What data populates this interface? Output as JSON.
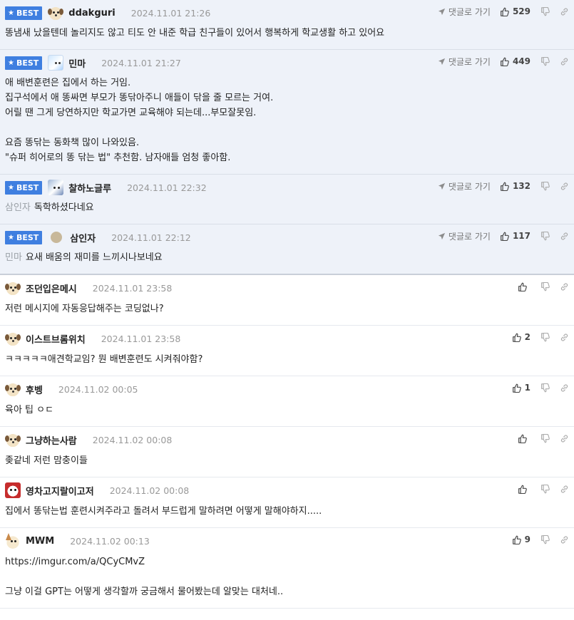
{
  "labels": {
    "best": "BEST",
    "goto_reply": "댓글로 가기"
  },
  "comments": [
    {
      "best": true,
      "avatar": "dog-icon",
      "nick": "ddakguri",
      "date": "2024.11.01 21:26",
      "likes": "529",
      "mention": "",
      "lines": [
        "똥냄새 났을텐데 놀리지도 않고 티도 안 내준 학급 친구들이 있어서 행복하게 학교생활 하고 있어요"
      ]
    },
    {
      "best": true,
      "avatar": "bear-icon",
      "nick": "민마",
      "date": "2024.11.01 21:27",
      "likes": "449",
      "mention": "",
      "lines": [
        "애 배변훈련은 집에서 하는 거임.",
        "집구석에서 애 똥싸면 부모가 똥닦아주니 애들이 닦을 줄 모르는 거여.",
        "어릴 땐 그게 당연하지만 학교가면 교육해야 되는데...부모잘못임.",
        "",
        "요즘 똥닦는 동화책 많이 나와있음.",
        "\"슈퍼 히어로의 똥 닦는 법\" 추천함. 남자애들 엄청 좋아함."
      ]
    },
    {
      "best": true,
      "avatar": "wolf-icon",
      "nick": "찰하노글루",
      "date": "2024.11.01 22:32",
      "likes": "132",
      "mention": "삼인자",
      "lines": [
        "독학하셨다네요"
      ]
    },
    {
      "best": true,
      "avatar": "circle-icon",
      "nick": "삼인자",
      "date": "2024.11.01 22:12",
      "likes": "117",
      "mention": "민마",
      "lines": [
        "요새 배움의 재미를 느끼시나보네요"
      ]
    },
    {
      "best": false,
      "avatar": "dog-icon",
      "nick": "조던입은메시",
      "date": "2024.11.01 23:58",
      "likes": "",
      "mention": "",
      "lines": [
        "저런 메시지에 자동응답해주는 코딩없나?"
      ]
    },
    {
      "best": false,
      "avatar": "dog-icon",
      "nick": "이스트브롬위치",
      "date": "2024.11.01 23:58",
      "likes": "2",
      "mention": "",
      "lines": [
        "ㅋㅋㅋㅋㅋ애견학교임? 뭔 배변훈련도 시켜줘야함?"
      ]
    },
    {
      "best": false,
      "avatar": "dog-icon",
      "nick": "후벵",
      "date": "2024.11.02 00:05",
      "likes": "1",
      "mention": "",
      "lines": [
        "육아 팁 ㅇㄷ"
      ]
    },
    {
      "best": false,
      "avatar": "dog-icon",
      "nick": "그냥하는사람",
      "date": "2024.11.02 00:08",
      "likes": "",
      "mention": "",
      "lines": [
        "좆같네 저런 맘충이들"
      ]
    },
    {
      "best": false,
      "avatar": "red-icon",
      "nick": "영차고지랄이고저",
      "date": "2024.11.02 00:08",
      "likes": "",
      "mention": "",
      "lines": [
        "집에서 똥닦는법 훈련시켜주라고 돌려서 부드럽게 말하려면 어떻게 말해야하지....."
      ]
    },
    {
      "best": false,
      "avatar": "fox-icon",
      "nick": "MWM",
      "date": "2024.11.02 00:13",
      "likes": "9",
      "mention": "",
      "lines": [
        "https://imgur.com/a/QCyCMvZ",
        "",
        "그냥 이걸 GPT는 어떻게 생각할까 궁금해서 물어봤는데 알맞는 대처네.."
      ]
    }
  ]
}
